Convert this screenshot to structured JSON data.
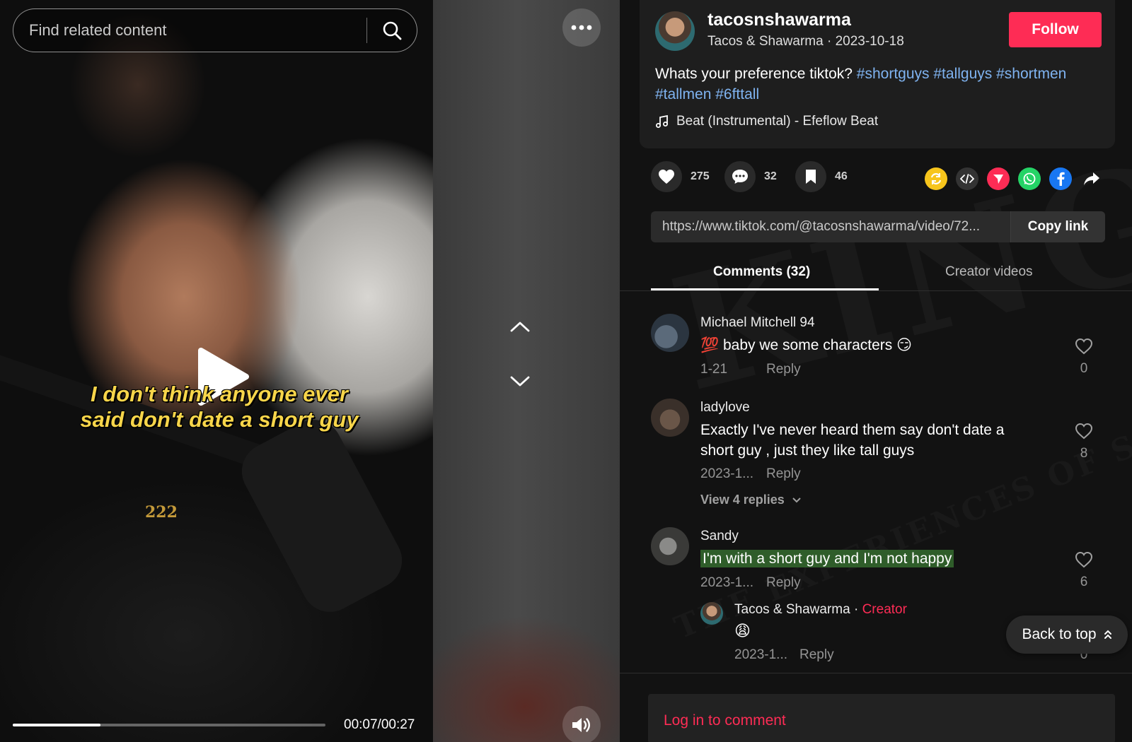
{
  "search": {
    "placeholder": "Find related content"
  },
  "video": {
    "caption_line1": "I don't think anyone ever",
    "caption_line2": "said don't date a short guy",
    "necklace_text": "222",
    "progress_fraction": 0.28,
    "current_time": "00:07",
    "duration": "00:27",
    "time_display": "00:07/00:27"
  },
  "background_watermark": {
    "main": "KINGZ",
    "sub": "THE EXPERIENCES OF SHORTER MEN"
  },
  "author": {
    "username": "tacosnshawarma",
    "meta": "Tacos & Shawarma · 2023-10-18",
    "follow_label": "Follow"
  },
  "description": {
    "text": "Whats your preference tiktok? ",
    "hashtags": [
      "#shortguys",
      "#tallguys",
      "#shortmen",
      "#tallmen",
      "#6fttall"
    ]
  },
  "music": {
    "label": "Beat (Instrumental) - Efeflow Beat"
  },
  "actions": {
    "likes": "275",
    "comments": "32",
    "saves": "46"
  },
  "share": {
    "icons": [
      "repost-icon",
      "embed-icon",
      "send-icon",
      "whatsapp-icon",
      "facebook-icon",
      "share-arrow-icon"
    ]
  },
  "link": {
    "url": "https://www.tiktok.com/@tacosnshawarma/video/72...",
    "copy_label": "Copy link"
  },
  "tabs": {
    "comments_label": "Comments (32)",
    "creator_label": "Creator videos"
  },
  "comments": [
    {
      "name": "Michael Mitchell 94",
      "text": "💯 baby we some characters 😏",
      "date": "1-21",
      "reply": "Reply",
      "likes": "0"
    },
    {
      "name": "ladylove",
      "text": "Exactly I've never heard them say don't date a short guy , just they like tall guys",
      "date": "2023-1...",
      "reply": "Reply",
      "likes": "8",
      "view_replies": "View 4 replies"
    },
    {
      "name": "Sandy",
      "text": "I'm with a short guy and I'm not happy",
      "date": "2023-1...",
      "reply": "Reply",
      "likes": "6"
    }
  ],
  "creator_reply": {
    "name": "Tacos & Shawarma",
    "separator": " · ",
    "badge": "Creator",
    "text": "😩",
    "date": "2023-1...",
    "reply": "Reply",
    "likes": "0"
  },
  "back_to_top": {
    "label": "Back to top"
  },
  "login": {
    "label": "Log in to comment"
  },
  "colors": {
    "accent": "#fe2c55",
    "hashtag": "#7fb3f0",
    "highlight": "#2f5d2a",
    "caption": "#f7d54a"
  }
}
